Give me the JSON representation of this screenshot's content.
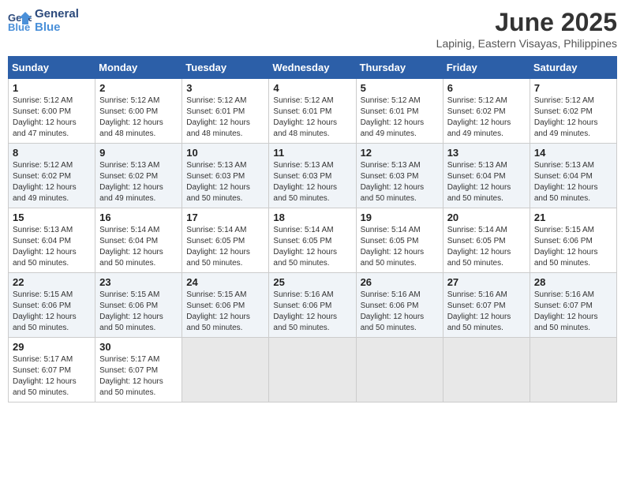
{
  "header": {
    "logo_line1": "General",
    "logo_line2": "Blue",
    "month": "June 2025",
    "location": "Lapinig, Eastern Visayas, Philippines"
  },
  "weekdays": [
    "Sunday",
    "Monday",
    "Tuesday",
    "Wednesday",
    "Thursday",
    "Friday",
    "Saturday"
  ],
  "weeks": [
    [
      {
        "day": "1",
        "info": "Sunrise: 5:12 AM\nSunset: 6:00 PM\nDaylight: 12 hours\nand 47 minutes."
      },
      {
        "day": "2",
        "info": "Sunrise: 5:12 AM\nSunset: 6:00 PM\nDaylight: 12 hours\nand 48 minutes."
      },
      {
        "day": "3",
        "info": "Sunrise: 5:12 AM\nSunset: 6:01 PM\nDaylight: 12 hours\nand 48 minutes."
      },
      {
        "day": "4",
        "info": "Sunrise: 5:12 AM\nSunset: 6:01 PM\nDaylight: 12 hours\nand 48 minutes."
      },
      {
        "day": "5",
        "info": "Sunrise: 5:12 AM\nSunset: 6:01 PM\nDaylight: 12 hours\nand 49 minutes."
      },
      {
        "day": "6",
        "info": "Sunrise: 5:12 AM\nSunset: 6:02 PM\nDaylight: 12 hours\nand 49 minutes."
      },
      {
        "day": "7",
        "info": "Sunrise: 5:12 AM\nSunset: 6:02 PM\nDaylight: 12 hours\nand 49 minutes."
      }
    ],
    [
      {
        "day": "8",
        "info": "Sunrise: 5:12 AM\nSunset: 6:02 PM\nDaylight: 12 hours\nand 49 minutes."
      },
      {
        "day": "9",
        "info": "Sunrise: 5:13 AM\nSunset: 6:02 PM\nDaylight: 12 hours\nand 49 minutes."
      },
      {
        "day": "10",
        "info": "Sunrise: 5:13 AM\nSunset: 6:03 PM\nDaylight: 12 hours\nand 50 minutes."
      },
      {
        "day": "11",
        "info": "Sunrise: 5:13 AM\nSunset: 6:03 PM\nDaylight: 12 hours\nand 50 minutes."
      },
      {
        "day": "12",
        "info": "Sunrise: 5:13 AM\nSunset: 6:03 PM\nDaylight: 12 hours\nand 50 minutes."
      },
      {
        "day": "13",
        "info": "Sunrise: 5:13 AM\nSunset: 6:04 PM\nDaylight: 12 hours\nand 50 minutes."
      },
      {
        "day": "14",
        "info": "Sunrise: 5:13 AM\nSunset: 6:04 PM\nDaylight: 12 hours\nand 50 minutes."
      }
    ],
    [
      {
        "day": "15",
        "info": "Sunrise: 5:13 AM\nSunset: 6:04 PM\nDaylight: 12 hours\nand 50 minutes."
      },
      {
        "day": "16",
        "info": "Sunrise: 5:14 AM\nSunset: 6:04 PM\nDaylight: 12 hours\nand 50 minutes."
      },
      {
        "day": "17",
        "info": "Sunrise: 5:14 AM\nSunset: 6:05 PM\nDaylight: 12 hours\nand 50 minutes."
      },
      {
        "day": "18",
        "info": "Sunrise: 5:14 AM\nSunset: 6:05 PM\nDaylight: 12 hours\nand 50 minutes."
      },
      {
        "day": "19",
        "info": "Sunrise: 5:14 AM\nSunset: 6:05 PM\nDaylight: 12 hours\nand 50 minutes."
      },
      {
        "day": "20",
        "info": "Sunrise: 5:14 AM\nSunset: 6:05 PM\nDaylight: 12 hours\nand 50 minutes."
      },
      {
        "day": "21",
        "info": "Sunrise: 5:15 AM\nSunset: 6:06 PM\nDaylight: 12 hours\nand 50 minutes."
      }
    ],
    [
      {
        "day": "22",
        "info": "Sunrise: 5:15 AM\nSunset: 6:06 PM\nDaylight: 12 hours\nand 50 minutes."
      },
      {
        "day": "23",
        "info": "Sunrise: 5:15 AM\nSunset: 6:06 PM\nDaylight: 12 hours\nand 50 minutes."
      },
      {
        "day": "24",
        "info": "Sunrise: 5:15 AM\nSunset: 6:06 PM\nDaylight: 12 hours\nand 50 minutes."
      },
      {
        "day": "25",
        "info": "Sunrise: 5:16 AM\nSunset: 6:06 PM\nDaylight: 12 hours\nand 50 minutes."
      },
      {
        "day": "26",
        "info": "Sunrise: 5:16 AM\nSunset: 6:06 PM\nDaylight: 12 hours\nand 50 minutes."
      },
      {
        "day": "27",
        "info": "Sunrise: 5:16 AM\nSunset: 6:07 PM\nDaylight: 12 hours\nand 50 minutes."
      },
      {
        "day": "28",
        "info": "Sunrise: 5:16 AM\nSunset: 6:07 PM\nDaylight: 12 hours\nand 50 minutes."
      }
    ],
    [
      {
        "day": "29",
        "info": "Sunrise: 5:17 AM\nSunset: 6:07 PM\nDaylight: 12 hours\nand 50 minutes."
      },
      {
        "day": "30",
        "info": "Sunrise: 5:17 AM\nSunset: 6:07 PM\nDaylight: 12 hours\nand 50 minutes."
      },
      {
        "day": "",
        "info": ""
      },
      {
        "day": "",
        "info": ""
      },
      {
        "day": "",
        "info": ""
      },
      {
        "day": "",
        "info": ""
      },
      {
        "day": "",
        "info": ""
      }
    ]
  ]
}
